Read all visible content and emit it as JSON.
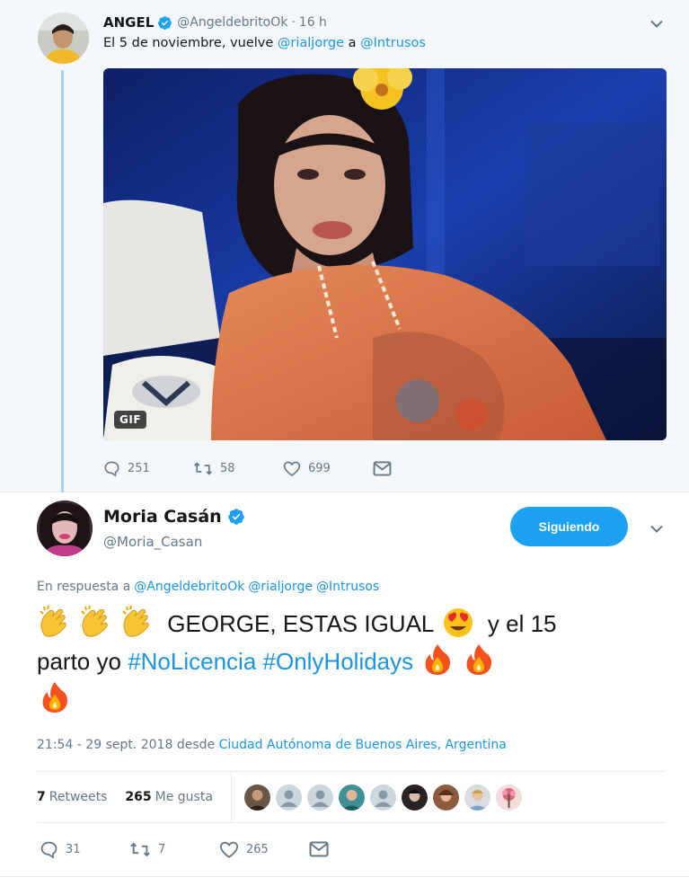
{
  "parent_tweet": {
    "author_name": "ANGEL",
    "handle": "@AngeldebritoOk",
    "separator": "·",
    "time": "16 h",
    "text_parts": [
      "El 5 de noviembre, vuelve ",
      "@rialjorge",
      " a ",
      "@Intrusos"
    ],
    "media_badge": "GIF",
    "counts": {
      "replies": "251",
      "retweets": "58",
      "likes": "699"
    }
  },
  "reply_tweet": {
    "author_name": "Moria Casán",
    "handle": "@Moria_Casan",
    "follow_label": "Siguiendo",
    "reply_to_prefix": "En respuesta a",
    "reply_to_handles": [
      "@AngeldebritoOk",
      "@rialjorge",
      "@Intrusos"
    ],
    "text_parts": {
      "main": "GEORGE, ESTAS IGUAL",
      "after_emoji": "y el 15",
      "line2_prefix": "parto yo",
      "hashtag1": "#NoLicencia",
      "hashtag2": "#OnlyHolidays"
    },
    "emojis": [
      "clapping-hands",
      "clapping-hands",
      "clapping-hands",
      "heart-eyes",
      "fire",
      "fire",
      "fire"
    ],
    "timestamp": "21:54 - 29 sept. 2018 desde",
    "location": "Ciudad Autónoma de Buenos Aires, Argentina",
    "stats": {
      "retweets_count": "7",
      "retweets_label": "Retweets",
      "likes_count": "265",
      "likes_label": "Me gusta"
    },
    "counts": {
      "replies": "31",
      "retweets": "7",
      "likes": "265"
    }
  },
  "colors": {
    "accent": "#1da1f2",
    "link": "#1b95e0",
    "muted": "#657786",
    "thread_line": "#a9d4f3",
    "parent_bg": "#f5f8fa"
  }
}
